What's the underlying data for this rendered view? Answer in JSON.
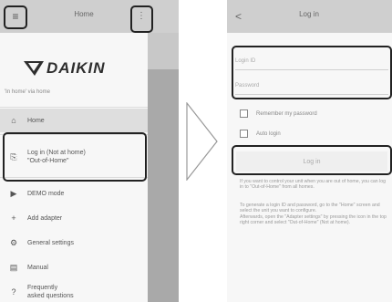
{
  "left_screen": {
    "title": "Home",
    "hamburger_glyph": "≡",
    "kebab_glyph": "⋮",
    "logo_text": "DAIKIN",
    "subtext": "'In home' via home",
    "menu": [
      {
        "icon": "home-icon",
        "glyph": "⌂",
        "label": "Home",
        "active": true
      },
      {
        "icon": "login-icon",
        "glyph": "⎘",
        "label_line1": "Log in (Not at home)",
        "label_line2": "\"Out-of-Home\""
      },
      {
        "icon": "demo-icon",
        "glyph": "▶",
        "label": "DEMO mode"
      },
      {
        "icon": "plus-icon",
        "glyph": "+",
        "label": "Add adapter"
      },
      {
        "icon": "gear-icon",
        "glyph": "⚙",
        "label": "General settings"
      },
      {
        "icon": "manual-icon",
        "glyph": "▤",
        "label": "Manual"
      },
      {
        "icon": "faq-icon",
        "glyph": "?",
        "label_line1": "Frequently",
        "label_line2": "asked questions"
      }
    ]
  },
  "right_screen": {
    "title": "Log in",
    "back_glyph": "<",
    "login_id_placeholder": "Login ID",
    "password_placeholder": "Password",
    "remember_label": "Remember my password",
    "auto_login_label": "Auto login",
    "login_button": "Log in",
    "para1": "If you want to control your unit when you are out of home, you can log in to \"Out-of-Home\" from all homes.",
    "para2": "To generate a login ID and password, go to the \"Home\" screen and select the unit you want to configure.\nAfterwards, open the \"Adapter settings\" by pressing the icon in the top right corner and select \"Out-of-Home\" (Not at home)."
  },
  "colors": {
    "topbar": "#cfcfcf",
    "drawer_bg": "#f7f7f7",
    "highlight_border": "#222222",
    "overlay_strip": "#a9a9a9"
  }
}
